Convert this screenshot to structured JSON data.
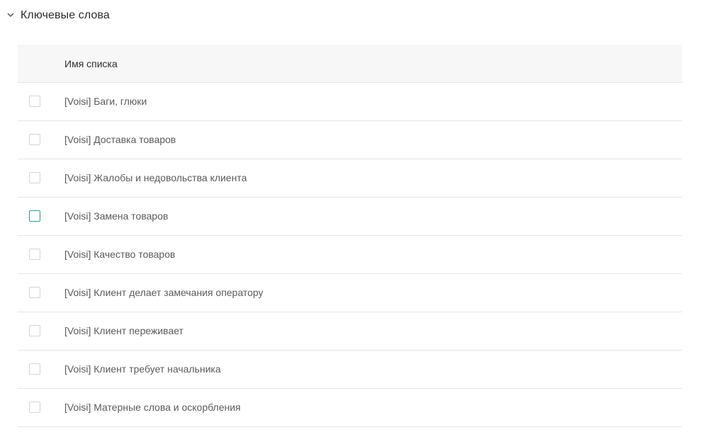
{
  "section": {
    "title": "Ключевые слова",
    "icon": "chevron-down-icon"
  },
  "table": {
    "column_header": "Имя списка",
    "rows": [
      {
        "name": "[Voisi] Баги, глюки",
        "checked": false
      },
      {
        "name": "[Voisi] Доставка товаров",
        "checked": false
      },
      {
        "name": "[Voisi] Жалобы и недовольства клиента",
        "checked": false
      },
      {
        "name": "[Voisi] Замена товаров",
        "checked": false,
        "focused": true
      },
      {
        "name": "[Voisi] Качество товаров",
        "checked": false
      },
      {
        "name": "[Voisi] Клиент делает замечания оператору",
        "checked": false
      },
      {
        "name": "[Voisi] Клиент переживает",
        "checked": false
      },
      {
        "name": "[Voisi] Клиент требует начальника",
        "checked": false
      },
      {
        "name": "[Voisi] Матерные слова и оскорбления",
        "checked": false
      }
    ]
  },
  "colors": {
    "focus_accent": "#2a9d8f",
    "header_bg": "#f7f7f7"
  }
}
